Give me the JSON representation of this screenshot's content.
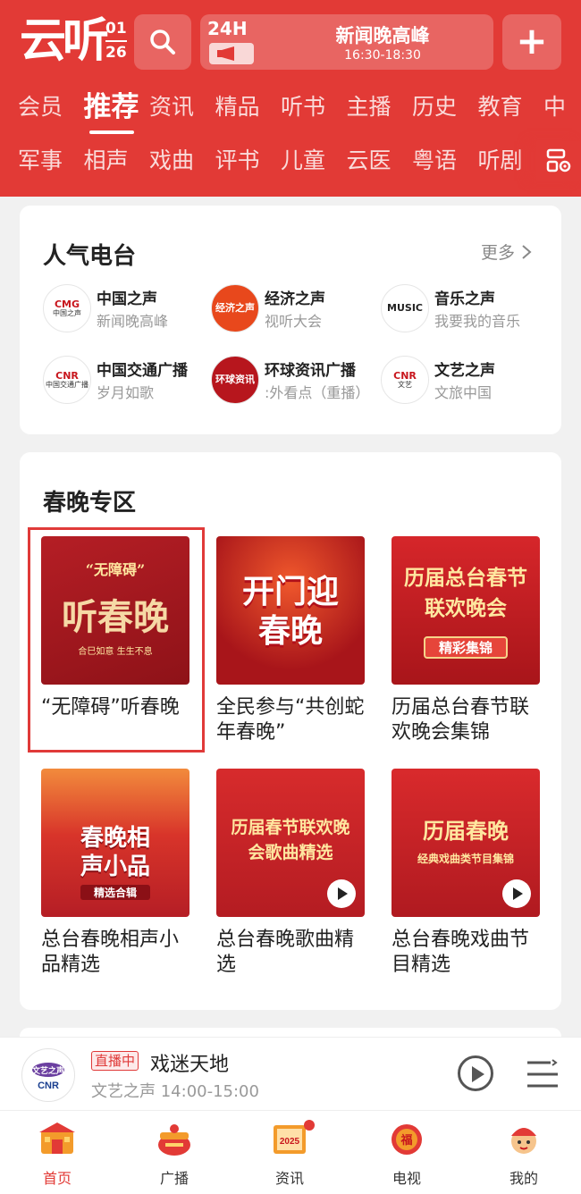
{
  "header": {
    "logo_text": "云听",
    "logo_month": "01",
    "logo_day": "26",
    "live_tag": "24H",
    "live_title": "新闻晚高峰",
    "live_time": "16:30-18:30",
    "plus_label": "+"
  },
  "tabs_row1": [
    "会员",
    "推荐",
    "资讯",
    "精品",
    "听书",
    "主播",
    "历史",
    "教育",
    "中"
  ],
  "tabs_row2": [
    "军事",
    "相声",
    "戏曲",
    "评书",
    "儿童",
    "云医",
    "粤语",
    "听剧"
  ],
  "active_tab": "推荐",
  "popular": {
    "title": "人气电台",
    "more": "更多",
    "stations": [
      {
        "name": "中国之声",
        "sub": "新闻晚高峰",
        "logo": "CMG",
        "logo_sub": "中国之声"
      },
      {
        "name": "经济之声",
        "sub": "视听大会",
        "logo": "经济之声"
      },
      {
        "name": "音乐之声",
        "sub": "我要我的音乐",
        "logo": "MUSIC"
      },
      {
        "name": "中国交通广播",
        "sub": "岁月如歌",
        "logo": "CNR",
        "logo_sub": "中国交通广播"
      },
      {
        "name": "环球资讯广播",
        "sub": ":外看点（重播）",
        "logo": "环球资讯"
      },
      {
        "name": "文艺之声",
        "sub": "文旅中国",
        "logo": "CNR",
        "logo_sub": "文艺"
      }
    ]
  },
  "spring": {
    "title": "春晚专区",
    "items": [
      {
        "text": "“无障碍”听春晚",
        "thumb_main": "听春晚",
        "thumb_tag": "“无障碍”",
        "thumb_foot": "合巳如意 生生不息"
      },
      {
        "text": "全民参与“共创蛇年春晚”",
        "thumb_main": "开门迎春晚"
      },
      {
        "text": "历届总台春节联欢晚会集锦",
        "thumb_main": "历届总台春节联欢晚会",
        "thumb_tag": "精彩集锦"
      },
      {
        "text": "总台春晚相声小品精选",
        "thumb_main": "春晚相声小品",
        "thumb_tag": "精选合辑"
      },
      {
        "text": "总台春晚歌曲精选",
        "thumb_main": "历届春节联欢晚会歌曲精选"
      },
      {
        "text": "总台春晚戏曲节目精选",
        "thumb_main": "历届春晚",
        "thumb_tag": "经典戏曲类节目集锦"
      }
    ]
  },
  "player": {
    "badge": "直播中",
    "title": "戏迷天地",
    "sub": "文艺之声 14:00-15:00",
    "avatar_text": "文艺之声",
    "avatar_sub": "CNR"
  },
  "bottom_nav": [
    {
      "label": "首页",
      "icon": "home-icon"
    },
    {
      "label": "广播",
      "icon": "radio-icon"
    },
    {
      "label": "资讯",
      "icon": "news-icon",
      "badge_text": "2025"
    },
    {
      "label": "电视",
      "icon": "tv-icon",
      "badge_text": "福"
    },
    {
      "label": "我的",
      "icon": "profile-icon"
    }
  ],
  "colors": {
    "brand": "#e23a36",
    "highlight": "#e03a39"
  }
}
